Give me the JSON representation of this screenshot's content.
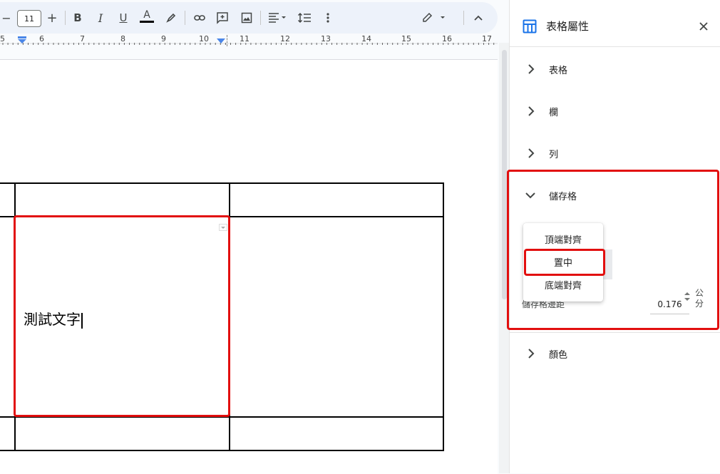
{
  "toolbar": {
    "font_size": "11",
    "minus_label": "−",
    "plus_label": "+",
    "bold_label": "B",
    "italic_label": "I",
    "underline_label": "U",
    "text_color_label": "A"
  },
  "ruler": {
    "numbers": [
      "5",
      "6",
      "7",
      "8",
      "9",
      "10",
      "11",
      "12",
      "13",
      "14",
      "15",
      "16",
      "17"
    ]
  },
  "document": {
    "cell_text": "測試文字"
  },
  "panel": {
    "title": "表格屬性",
    "sections": {
      "table": "表格",
      "column": "欄",
      "row": "列",
      "cell": "儲存格",
      "color": "顏色"
    },
    "vertical_align_menu": {
      "options": [
        "頂端對齊",
        "置中",
        "底端對齊"
      ],
      "highlighted": "置中"
    },
    "cell_padding": {
      "label": "儲存格邊距",
      "value": "0.176",
      "unit": "公分"
    }
  },
  "colors": {
    "annotation_red": "#e20f0f",
    "toolbar_bg": "#edf2fa",
    "ruler_marker": "#4a86e8"
  }
}
